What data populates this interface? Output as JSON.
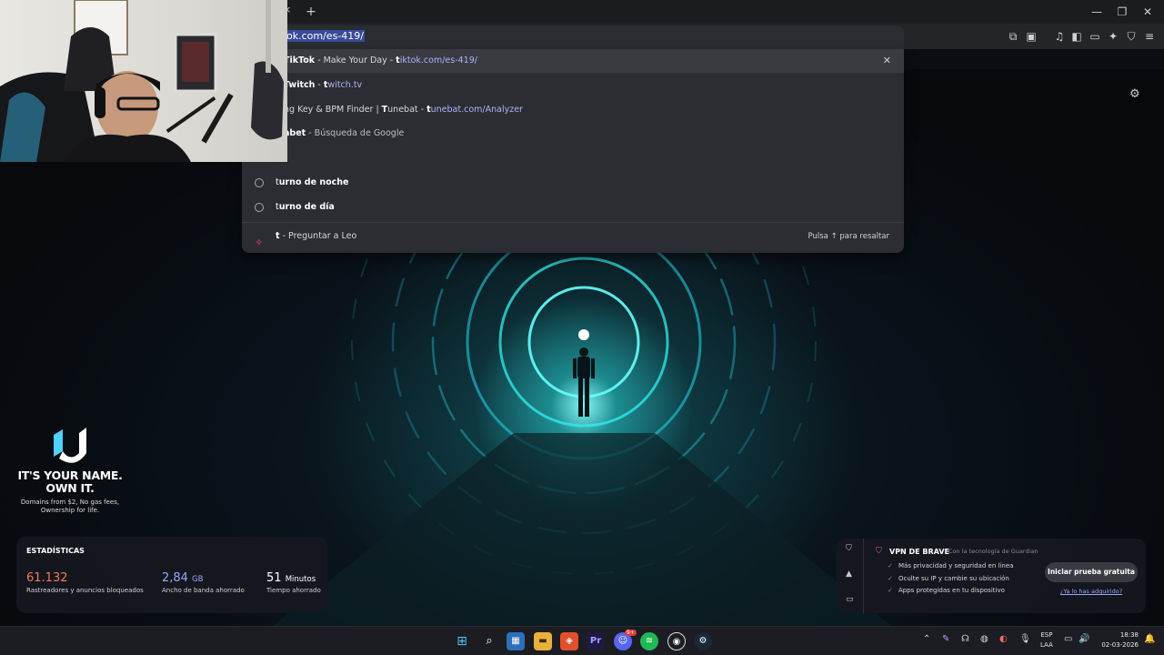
{
  "browser": {
    "address_value": "tiktok.com/es-419/",
    "address_visible": "ok.com/es-419/",
    "new_tab_label": "+",
    "tab_close": "×"
  },
  "suggestions": [
    {
      "prefix": "",
      "bold": "TikTok",
      "title": " - Make Your Day - ",
      "url_bold": "t",
      "url": "iktok.com/es-419/",
      "visible_prefix": "l"
    },
    {
      "prefix": "",
      "bold": "Twitch",
      "title": " - ",
      "url_bold": "t",
      "url": "witch.tv",
      "visible_prefix": ""
    },
    {
      "prefix": "ng Key & BPM Finder | ",
      "bold": "T",
      "title": "unebat - ",
      "url_bold": "t",
      "url": "unebat.com/Analyzer",
      "visible_prefix": ""
    },
    {
      "prefix": "",
      "bold": "abet",
      "title": " - Búsqueda de Google",
      "url_bold": "",
      "url": "",
      "visible_prefix": ""
    }
  ],
  "history": [
    {
      "bold": "t",
      "rest": "urno de noche"
    },
    {
      "bold": "t",
      "rest": "urno de día"
    }
  ],
  "leo": {
    "query": "t",
    "label": " - Preguntar a Leo",
    "hint": "Pulsa ↑ para resaltar"
  },
  "promo": {
    "headline1": "IT'S YOUR NAME.",
    "headline2": "OWN IT.",
    "sub1": "Domains from $2, No gas fees,",
    "sub2": "Ownership for life."
  },
  "stats": {
    "title": "ESTADÍSTICAS",
    "trackers_value": "61.132",
    "trackers_label": "Rastreadores y anuncios bloqueados",
    "bandwidth_value": "2,84",
    "bandwidth_unit": "GB",
    "bandwidth_label": "Ancho de banda ahorrado",
    "time_value": "51",
    "time_unit": "Minutos",
    "time_label": "Tiempo ahorrado",
    "colors": {
      "trackers": "#f07a5a",
      "bandwidth": "#9aa6ff",
      "time": "#ffffff"
    }
  },
  "vpn": {
    "title": "VPN DE BRAVE",
    "powered_by": "Con la tecnología de",
    "powered_brand": "Guardian",
    "items": [
      "Más privacidad y seguridad en línea",
      "Oculte su IP y cambie su ubicación",
      "Apps protegidas en tu dispositivo"
    ],
    "cta": "Iniciar prueba gratuita",
    "link": "¿Ya lo has adquirido?"
  },
  "taskbar": {
    "lang_line1": "ESP",
    "lang_line2": "LAA",
    "time": "18:38",
    "date": "02-03-2026",
    "discord_badge": "9+"
  }
}
